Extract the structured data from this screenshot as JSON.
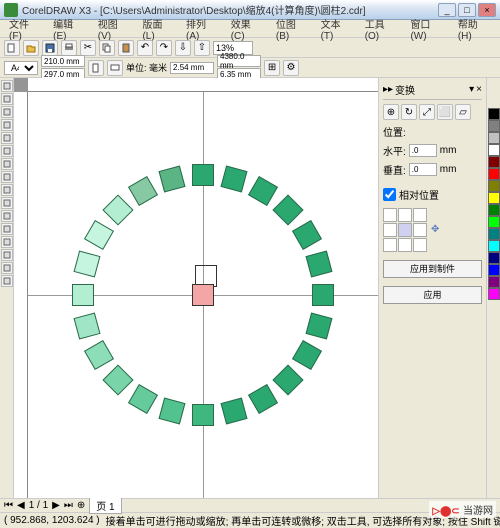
{
  "title": "CorelDRAW X3 - [C:\\Users\\Administrator\\Desktop\\缩放4(计算角度)\\圆柱2.cdr]",
  "menu": [
    "文件(F)",
    "编辑(E)",
    "视图(V)",
    "版面(L)",
    "排列(A)",
    "效果(C)",
    "位图(B)",
    "文本(T)",
    "工具(O)",
    "窗口(W)",
    "帮助(H)"
  ],
  "zoom": "13%",
  "paper": "A4",
  "dims": {
    "w": "210.0 mm",
    "h": "297.0 mm"
  },
  "units": "单位: 毫米",
  "offset": {
    "x": "2.54 mm",
    "y": ""
  },
  "dup": {
    "x": "4380.0 mm",
    "y": "6.35 mm"
  },
  "docker": {
    "title": "变换",
    "section": "位置:",
    "hlabel": "水平:",
    "hval": ".0",
    "hunit": "mm",
    "vlabel": "垂直:",
    "vval": ".0",
    "vunit": "mm",
    "rel": "相对位置",
    "btn1": "应用到制件",
    "btn2": "应用"
  },
  "palette": [
    "#000000",
    "#808080",
    "#c0c0c0",
    "#ffffff",
    "#800000",
    "#ff0000",
    "#808000",
    "#ffff00",
    "#008000",
    "#00ff00",
    "#008080",
    "#00ffff",
    "#000080",
    "#0000ff",
    "#800080",
    "#ff00ff"
  ],
  "pagetab": {
    "page": "1 / 1",
    "tab": "页 1"
  },
  "status": {
    "coords": "( 952.868, 1203.624 )",
    "hint": "接着单击可进行拖动或缩放; 再单击可连转或微移; 双击工具, 可选择所有对象; 按住 Shift 键单击可选择多个对象"
  },
  "watermark": {
    "brand": "当游网"
  },
  "ring": {
    "count": 24,
    "radius": 120,
    "size": 22,
    "colors": [
      "#2aa870",
      "#2aa870",
      "#2aa870",
      "#2aa870",
      "#2aa870",
      "#2aa870",
      "#2aa870",
      "#2aa870",
      "#2aa870",
      "#2aa870",
      "#2aa870",
      "#2aa870",
      "#3fb880",
      "#52c28e",
      "#66cb9c",
      "#79d4aa",
      "#8dddb8",
      "#a0e6c6",
      "#b3eed3",
      "#c5f4df",
      "#c5f4df",
      "#b3eed3",
      "#86c9a2",
      "#5ab484"
    ]
  }
}
